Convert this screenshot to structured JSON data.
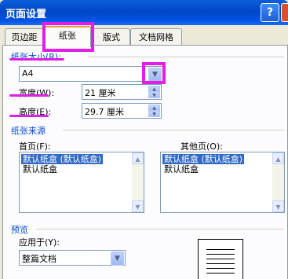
{
  "window": {
    "title": "页面设置",
    "help_glyph": "?",
    "close_glyph": "✕"
  },
  "tabs": [
    "页边距",
    "纸张",
    "版式",
    "文档网格"
  ],
  "paper_size": {
    "group_label": "纸张大小(R):",
    "selected": "A4",
    "width_label": "宽度(W):",
    "width_value": "21 厘米",
    "height_label": "高度(E):",
    "height_value": "29.7 厘米"
  },
  "paper_source": {
    "group_label": "纸张来源",
    "first_page_label": "首页(F):",
    "other_pages_label": "其他页(O):",
    "first_page_items": [
      "默认纸盒 (默认纸盒)",
      "默认纸盒"
    ],
    "other_pages_items": [
      "默认纸盒 (默认纸盒)",
      "默认纸盒"
    ]
  },
  "preview": {
    "group_label": "预览",
    "apply_to_label": "应用于(Y):",
    "apply_to_value": "整篇文档"
  },
  "highlight_color": "#e01ee6"
}
